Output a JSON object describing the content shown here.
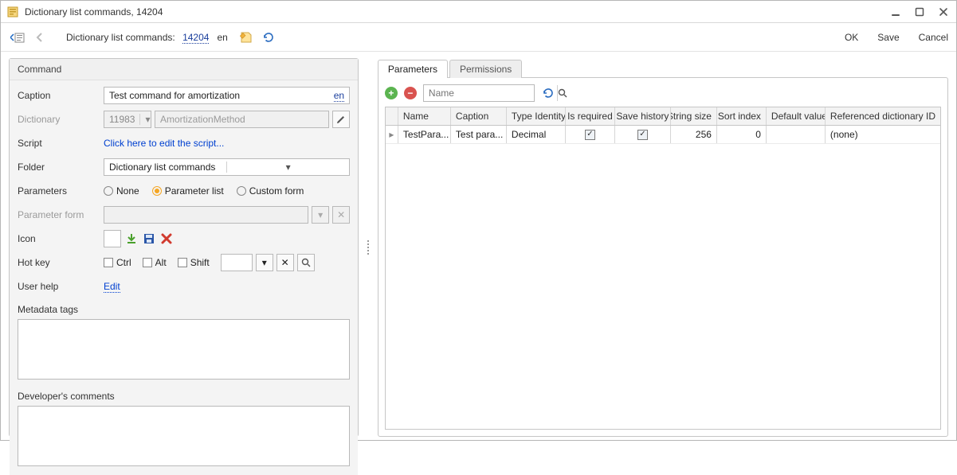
{
  "window": {
    "title": "Dictionary list commands, 14204"
  },
  "toolbar": {
    "crumb_prefix": "Dictionary list commands:",
    "crumb_id": "14204",
    "lang": "en",
    "ok": "OK",
    "save": "Save",
    "cancel": "Cancel"
  },
  "command": {
    "group_title": "Command",
    "labels": {
      "caption": "Caption",
      "dictionary": "Dictionary",
      "script": "Script",
      "folder": "Folder",
      "parameters": "Parameters",
      "parameter_form": "Parameter form",
      "icon": "Icon",
      "hotkey": "Hot key",
      "user_help": "User help",
      "metadata_tags": "Metadata tags",
      "developer_comments": "Developer's comments"
    },
    "caption_value": "Test command for amortization",
    "caption_lang": "en",
    "dictionary_id": "11983",
    "dictionary_name": "AmortizationMethod",
    "script_link": "Click here to edit the script...",
    "folder_value": "Dictionary list commands",
    "parameters_radio": {
      "none": "None",
      "list": "Parameter list",
      "custom": "Custom form"
    },
    "hotkey": {
      "ctrl": "Ctrl",
      "alt": "Alt",
      "shift": "Shift"
    },
    "user_help_link": "Edit"
  },
  "tabs": {
    "parameters": "Parameters",
    "permissions": "Permissions"
  },
  "params_panel": {
    "search_placeholder": "Name",
    "columns": {
      "name": "Name",
      "caption": "Caption",
      "type": "Type Identity",
      "required": "Is required",
      "history": "Save history",
      "strsize": "String size",
      "sort": "Sort index",
      "default": "Default value",
      "ref": "Referenced dictionary ID"
    },
    "rows": [
      {
        "name": "TestPara...",
        "caption": "Test para...",
        "type": "Decimal",
        "required": true,
        "history": true,
        "strsize": "256",
        "sort": "0",
        "default": "",
        "ref": "(none)"
      }
    ]
  }
}
